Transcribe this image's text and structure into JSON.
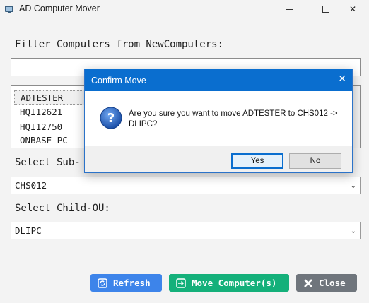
{
  "window": {
    "title": "AD Computer Mover",
    "icon": "app-icon",
    "controls": {
      "minimize": "minimize-icon",
      "maximize": "maximize-icon",
      "close": "✕"
    }
  },
  "filter": {
    "label": "Filter Computers from NewComputers:",
    "value": "",
    "placeholder": ""
  },
  "computers": {
    "items": [
      "ADTESTER",
      "HQI12621",
      "HQI12750",
      "ONBASE-PC"
    ],
    "selected": "ADTESTER"
  },
  "sub_ou": {
    "label": "Select Sub-OU:",
    "visible_label": "Select Sub-",
    "value": "CHS012"
  },
  "child_ou": {
    "label": "Select Child-OU:",
    "value": "DLIPC"
  },
  "buttons": {
    "refresh": "Refresh",
    "move": "Move Computer(s)",
    "close": "Close"
  },
  "dialog": {
    "title": "Confirm Move",
    "close_glyph": "✕",
    "icon": "question-icon",
    "message_line1": "Are you sure you want to move ADTESTER to CHS012 ->",
    "message_line2": "DLIPC?",
    "yes": "Yes",
    "no": "No"
  },
  "colors": {
    "refresh": "#3d84ea",
    "move": "#14b07a",
    "close": "#6f757c",
    "dialog_title": "#0a6ecf"
  }
}
